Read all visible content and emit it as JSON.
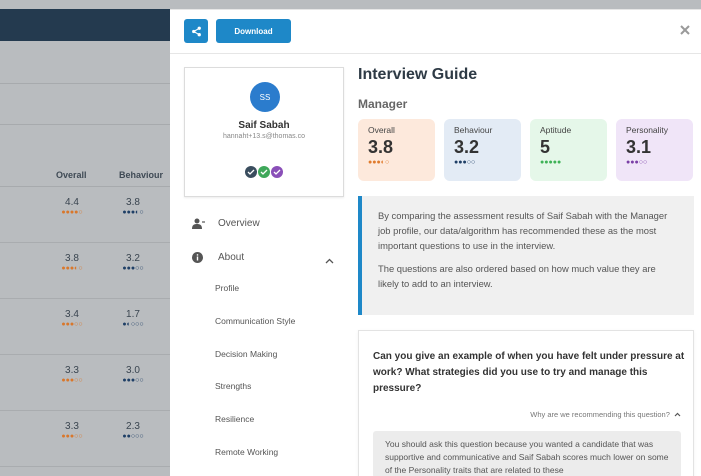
{
  "background": {
    "columns": [
      "Overall",
      "Behaviour"
    ],
    "rows": [
      {
        "overall": "4.4",
        "overall_level": 4.4,
        "behaviour": "3.8",
        "behaviour_level": 3.8
      },
      {
        "overall": "3.8",
        "overall_level": 3.8,
        "behaviour": "3.2",
        "behaviour_level": 3.2
      },
      {
        "overall": "3.4",
        "overall_level": 3.4,
        "behaviour": "1.7",
        "behaviour_level": 1.7
      },
      {
        "overall": "3.3",
        "overall_level": 3.3,
        "behaviour": "3.0",
        "behaviour_level": 3.0
      },
      {
        "overall": "3.3",
        "overall_level": 3.3,
        "behaviour": "2.3",
        "behaviour_level": 2.3
      }
    ]
  },
  "toolbar": {
    "share_icon": "share-icon",
    "download_label": "Download",
    "close_icon": "close-icon"
  },
  "candidate": {
    "initials": "SS",
    "name": "Saif Sabah",
    "email": "hannaht+13.s@thomas.co",
    "badges": [
      "badge-dark",
      "badge-green",
      "badge-purple"
    ]
  },
  "nav": {
    "overview": "Overview",
    "about": "About",
    "sub_items": [
      "Profile",
      "Communication Style",
      "Decision Making",
      "Strengths",
      "Resilience",
      "Remote Working"
    ]
  },
  "main": {
    "title": "Interview Guide",
    "role": "Manager",
    "scores": [
      {
        "label": "Overall",
        "value": "3.8",
        "level": 3.8,
        "bg": "#fde9dc",
        "dot": "#e07b2c"
      },
      {
        "label": "Behaviour",
        "value": "3.2",
        "level": 3.2,
        "bg": "#e3ebf5",
        "dot": "#1f3f66"
      },
      {
        "label": "Aptitude",
        "value": "5",
        "level": 5,
        "bg": "#e5f7e9",
        "dot": "#3fb257"
      },
      {
        "label": "Personality",
        "value": "3.1",
        "level": 3.1,
        "bg": "#f0e5f8",
        "dot": "#7a3fa6"
      }
    ],
    "info_p1": "By comparing the assessment results of Saif Sabah with the Manager job profile, our data/algorithm has recommended these as the most important questions to use in the interview.",
    "info_p2": "The questions are also ordered based on how much value they are likely to add to an interview.",
    "question": "Can you give an example of when you have felt under pressure at work? What strategies did you use to try and manage this pressure?",
    "why_label": "Why are we recommending this question?",
    "explanation": "You should ask this question because you wanted a candidate that was supportive and communicative and Saif Sabah scores much lower on some of the Personality traits that are related to these"
  },
  "colors": {
    "accent": "#1e88c8",
    "header_dark": "#243a4f",
    "bg_overall_dot": "#d9772b",
    "bg_behaviour_dot": "#1f3f66"
  }
}
